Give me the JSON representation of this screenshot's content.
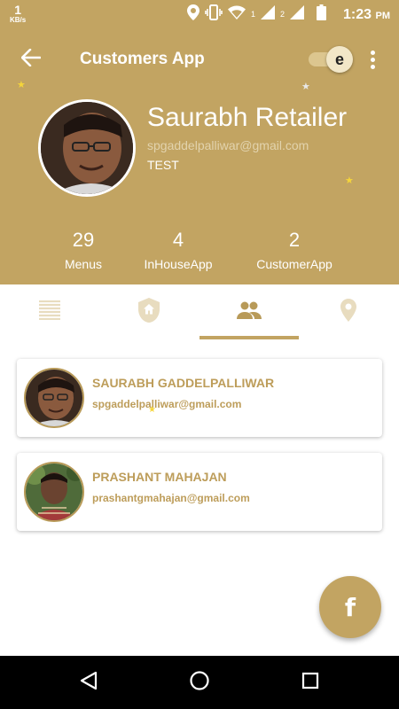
{
  "status_bar": {
    "speed_value": "1",
    "speed_unit": "KB/s",
    "sim1": "1",
    "sim2": "2",
    "time": "1:23",
    "ampm": "PM"
  },
  "toolbar": {
    "title": "Customers App",
    "toggle_letter": "e"
  },
  "profile": {
    "name": "Saurabh Retailer",
    "email": "spgaddelpalliwar@gmail.com",
    "tag": "TEST"
  },
  "stats": [
    {
      "value": "29",
      "label": "Menus"
    },
    {
      "value": "4",
      "label": "InHouseApp"
    },
    {
      "value": "2",
      "label": "CustomerApp"
    }
  ],
  "tabs": [
    {
      "icon": "list-icon",
      "active": false
    },
    {
      "icon": "shield-home-icon",
      "active": false
    },
    {
      "icon": "people-icon",
      "active": true
    },
    {
      "icon": "location-pin-icon",
      "active": false
    }
  ],
  "customers": [
    {
      "name": "SAURABH GADDELPALLIWAR",
      "email": "spgaddelpalliwar@gmail.com"
    },
    {
      "name": "PRASHANT MAHAJAN",
      "email": "prashantgmahajan@gmail.com"
    }
  ],
  "fab": {
    "icon": "facebook-icon",
    "letter": "f"
  },
  "navigation": {
    "icons": [
      "back-triangle-icon",
      "home-circle-icon",
      "recents-square-icon"
    ]
  },
  "colors": {
    "primary": "#c2a462",
    "accent_text": "#bd9d5a",
    "inactive_icon": "#e8dcbf",
    "active_icon": "#b89a58"
  }
}
